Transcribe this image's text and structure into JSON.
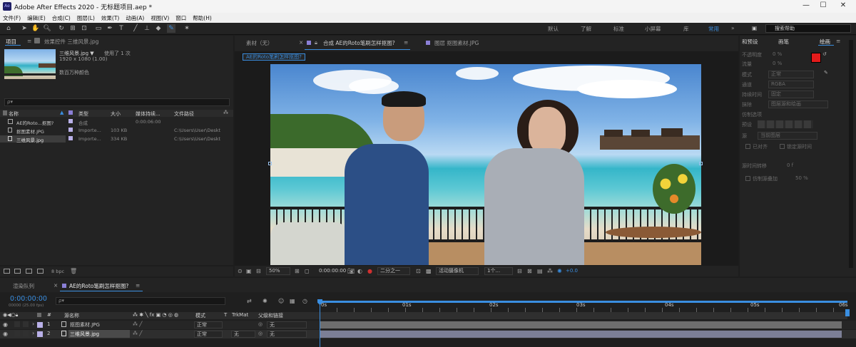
{
  "app": {
    "title": "Adobe After Effects 2020 - 无标题项目.aep *",
    "icon_text": "Ae",
    "window_buttons": [
      "—",
      "☐",
      "✕"
    ]
  },
  "menu": [
    "文件(F)",
    "编辑(E)",
    "合成(C)",
    "图层(L)",
    "效果(T)",
    "动画(A)",
    "视图(V)",
    "窗口",
    "帮助(H)"
  ],
  "workspaces": [
    "默认",
    "了解",
    "标准",
    "小屏幕",
    "库",
    "常用"
  ],
  "active_workspace": "常用",
  "search_help": "搜索帮助",
  "project_panel": {
    "tabs": [
      "项目",
      "效果控件 三维风景.jpg"
    ],
    "selected_name": "三维风景.jpg ▼",
    "used_text": "使用了 1 次",
    "resolution": "1920 x 1080 (1.00)",
    "color_depth": "数百万种颜色",
    "search_placeholder": "ρ▾",
    "columns": [
      "名称",
      "类型",
      "大小",
      "媒体持续...",
      "文件路径"
    ],
    "rows": [
      {
        "name": "AE的Roto...抠图?",
        "type": "合成",
        "size": "",
        "duration": "0:00:06:00",
        "path": ""
      },
      {
        "name": "抠图素材.JPG",
        "type": "Importe...",
        "size": "103 KB",
        "duration": "",
        "path": "C:\\Users\\User\\Deskt"
      },
      {
        "name": "三维风景.jpg",
        "type": "Importe...",
        "size": "334 KB",
        "duration": "",
        "path": "C:\\Users\\User\\Deskt"
      }
    ],
    "bpc": "8 bpc"
  },
  "viewer": {
    "tabs": [
      "素材（无）",
      "合成 AE的Roto笔刷怎样抠图?",
      "图层 抠图素材.JPG"
    ],
    "comp_chip": "AE的Roto笔刷怎样抠图?",
    "zoom": "50%",
    "timecode": "0:00:00:00",
    "resolution": "二分之一",
    "camera": "活动摄像机",
    "views": "1个...",
    "exposure": "+0.0"
  },
  "right_panel": {
    "tabs": [
      "和预设",
      "画笔",
      "绘画"
    ],
    "paint_labels": [
      "不透明度",
      "流量",
      "模式",
      "通道",
      "持续时间",
      "抹除",
      "仿制选项",
      "预设",
      "源",
      "已对齐",
      "锁定源时间",
      "源时间转移",
      "仿制源叠加"
    ],
    "paint_values": [
      "0 %",
      "0 %",
      "正常",
      "RGBA",
      "固定",
      "图层源和绘画",
      "",
      "",
      "当前图层",
      "",
      "",
      "0 f",
      "50 %"
    ],
    "foreground_color": "#e31b1b",
    "background_color": "#ffffff"
  },
  "timeline": {
    "tabs": [
      "渲染队列",
      "AE的Roto笔刷怎样抠图?"
    ],
    "timecode": "0:00:00:00",
    "fps": "00000 (25.00 fps)",
    "search_placeholder": "ρ▾",
    "columns": [
      "#",
      "源名称",
      "模式",
      "T",
      "TrkMat",
      "父级和链接"
    ],
    "ruler": [
      "0s",
      "01s",
      "02s",
      "03s",
      "04s",
      "05s",
      "06s"
    ],
    "layers": [
      {
        "num": "1",
        "name": "抠图素材.JPG",
        "mode": "正常",
        "trkmat": "",
        "parent": "无"
      },
      {
        "num": "2",
        "name": "三维风景.jpg",
        "mode": "正常",
        "trkmat": "无",
        "parent": "无"
      }
    ]
  },
  "colors": {
    "accent": "#3a8ee0",
    "panel": "#232323",
    "label_purple": "#8b7fd6",
    "layer_bar": "#686868",
    "playhead": "#3a8ee0"
  }
}
